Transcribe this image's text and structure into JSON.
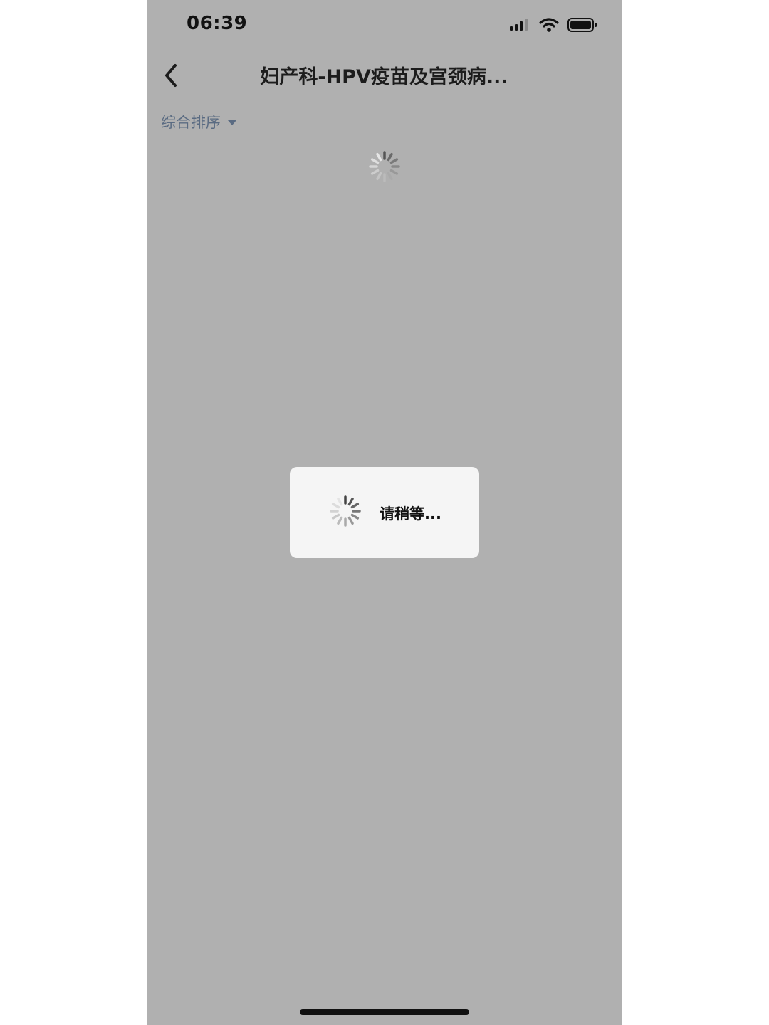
{
  "status_bar": {
    "time": "06:39",
    "icons": [
      "cellular-signal-icon",
      "wifi-icon",
      "battery-icon"
    ]
  },
  "nav": {
    "back_icon": "chevron-left-icon",
    "title": "妇产科-HPV疫苗及宫颈病..."
  },
  "filter": {
    "sort_label": "综合排序",
    "sort_icon": "caret-down-icon"
  },
  "loading": {
    "list_spinner": "loading-spinner-icon",
    "toast_text": "请稍等..."
  },
  "colors": {
    "overlay": "#b0b0b0",
    "toast_bg": "#f5f5f5",
    "filter_text": "#5a6b82"
  }
}
